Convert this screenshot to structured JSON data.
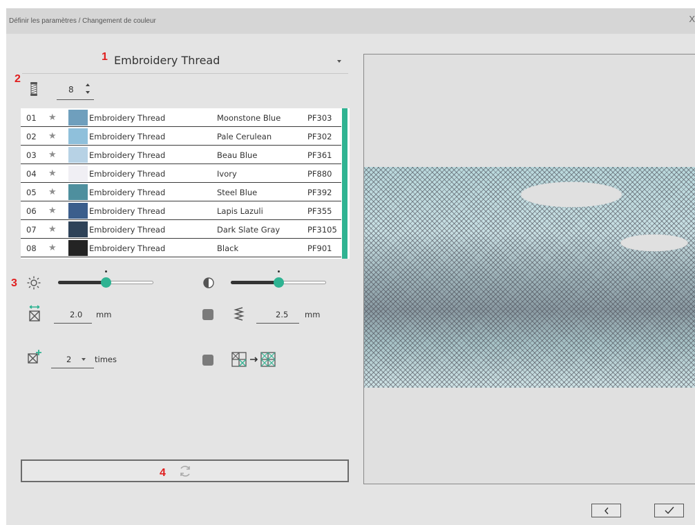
{
  "window": {
    "title": "Définir les paramètres / Changement de couleur",
    "close_label": "X"
  },
  "annotations": {
    "n1": "1",
    "n2": "2",
    "n3": "3",
    "n4": "4"
  },
  "thread_select": {
    "value": "Embroidery Thread"
  },
  "color_count": {
    "value": "8"
  },
  "threads": [
    {
      "num": "01",
      "brand": "Embroidery Thread",
      "name": "Moonstone Blue",
      "code": "PF303",
      "color": "#6f9fbd"
    },
    {
      "num": "02",
      "brand": "Embroidery Thread",
      "name": "Pale Cerulean",
      "code": "PF302",
      "color": "#8fc0db"
    },
    {
      "num": "03",
      "brand": "Embroidery Thread",
      "name": "Beau Blue",
      "code": "PF361",
      "color": "#b7d2e5"
    },
    {
      "num": "04",
      "brand": "Embroidery Thread",
      "name": "Ivory",
      "code": "PF880",
      "color": "#f0eff4"
    },
    {
      "num": "05",
      "brand": "Embroidery Thread",
      "name": "Steel Blue",
      "code": "PF392",
      "color": "#4e8f9e"
    },
    {
      "num": "06",
      "brand": "Embroidery Thread",
      "name": "Lapis Lazuli",
      "code": "PF355",
      "color": "#3b5e8c"
    },
    {
      "num": "07",
      "brand": "Embroidery Thread",
      "name": "Dark Slate Gray",
      "code": "PF3105",
      "color": "#2e4258"
    },
    {
      "num": "08",
      "brand": "Embroidery Thread",
      "name": "Black",
      "code": "PF901",
      "color": "#242424"
    }
  ],
  "brightness": {
    "icon": "sun-icon",
    "level": 0.5
  },
  "contrast": {
    "icon": "contrast-icon",
    "level": 0.5
  },
  "cross_size": {
    "value": "2.0",
    "unit": "mm"
  },
  "zigzag": {
    "value": "2.5",
    "unit": "mm"
  },
  "repeat": {
    "value": "2",
    "unit": "times"
  },
  "colors": {
    "accent": "#2fb392",
    "annotation_red": "#e01e1e"
  }
}
